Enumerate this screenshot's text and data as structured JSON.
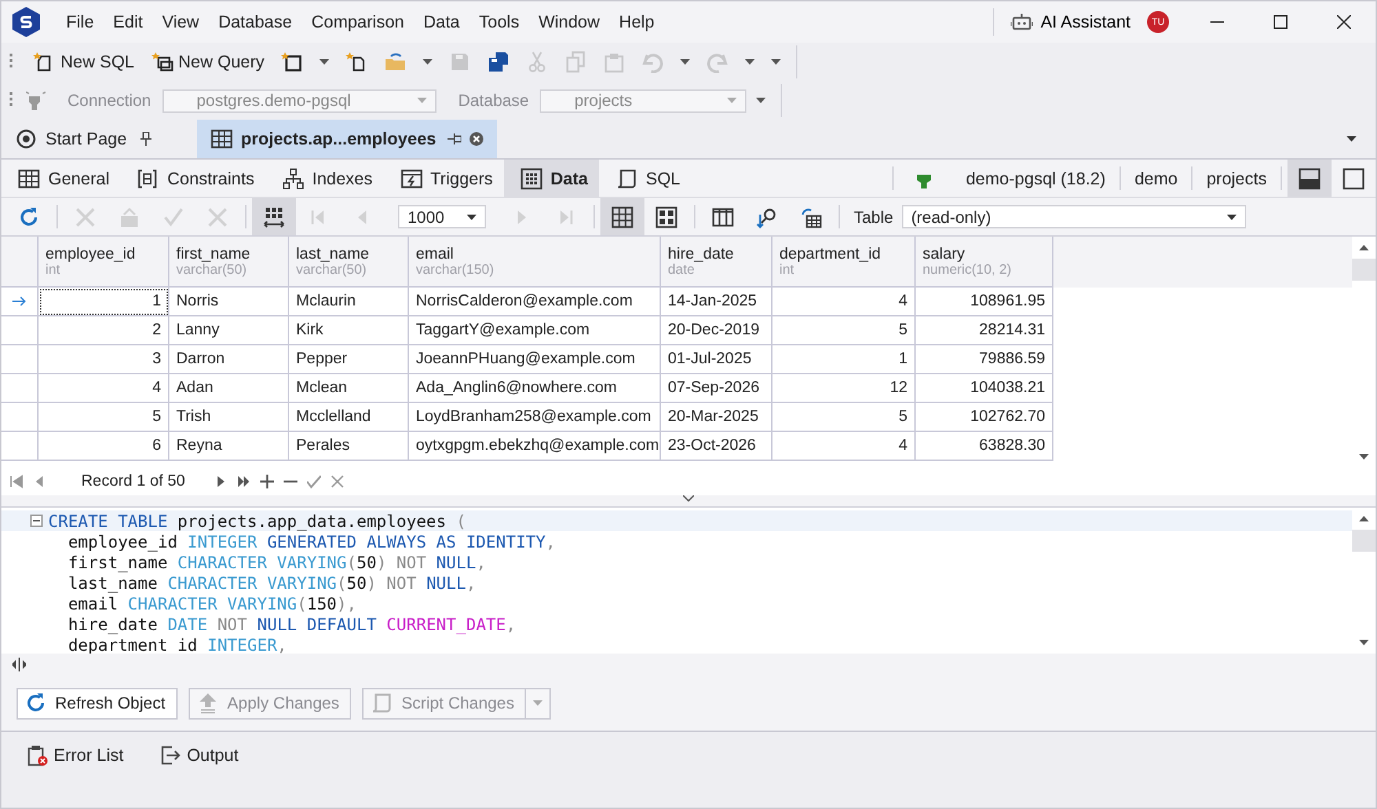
{
  "menu": [
    "File",
    "Edit",
    "View",
    "Database",
    "Comparison",
    "Data",
    "Tools",
    "Window",
    "Help"
  ],
  "ai_assistant": "AI Assistant",
  "avatar": "TU",
  "toolbar": [
    {
      "label": "New SQL",
      "disabled": false,
      "dropdown": false
    },
    {
      "label": "New Query",
      "disabled": false,
      "dropdown": false
    },
    {
      "disabled": false,
      "dropdown": true
    },
    {
      "disabled": false,
      "dropdown": false
    },
    {
      "disabled": false,
      "dropdown": true
    },
    {
      "disabled": true,
      "dropdown": false
    },
    {
      "disabled": false,
      "dropdown": false
    },
    {
      "disabled": true,
      "dropdown": false
    },
    {
      "disabled": true,
      "dropdown": false
    },
    {
      "disabled": true,
      "dropdown": false
    },
    {
      "disabled": true,
      "dropdown": true
    },
    {
      "disabled": true,
      "dropdown": true
    }
  ],
  "connection": {
    "label": "Connection",
    "value": "postgres.demo-pgsql",
    "disabled": true
  },
  "database": {
    "label": "Database",
    "value": "projects",
    "disabled": true
  },
  "doc_tabs": [
    {
      "label": "Start Page",
      "selected": false
    },
    {
      "label": "projects.ap...employees",
      "selected": true
    }
  ],
  "editor_tabs": [
    {
      "label": "General",
      "selected": false
    },
    {
      "label": "Constraints",
      "selected": false
    },
    {
      "label": "Indexes",
      "selected": false
    },
    {
      "label": "Triggers",
      "selected": false
    },
    {
      "label": "Data",
      "selected": true
    },
    {
      "label": "SQL",
      "selected": false
    }
  ],
  "connection_info": [
    "demo-pgsql (18.2)",
    "demo",
    "projects"
  ],
  "layout_buttons": [
    {
      "selected": true
    },
    {
      "selected": false
    }
  ],
  "data_toolbar": [
    {
      "disabled": false,
      "selected": false
    },
    {
      "disabled": true,
      "selected": false
    },
    {
      "disabled": true,
      "selected": false
    },
    {
      "disabled": true,
      "selected": false
    },
    {
      "disabled": true,
      "selected": false
    },
    {
      "disabled": false,
      "selected": true
    },
    {
      "disabled": true,
      "selected": false
    },
    {
      "disabled": true,
      "selected": false
    }
  ],
  "page_size": "1000",
  "data_toolbar_right": [
    {
      "disabled": true,
      "selected": false
    },
    {
      "disabled": true,
      "selected": false
    },
    {
      "disabled": false,
      "selected": true
    },
    {
      "disabled": false,
      "selected": false
    },
    {
      "disabled": false,
      "selected": false
    },
    {
      "disabled": false,
      "selected": false
    },
    {
      "disabled": false,
      "selected": false
    }
  ],
  "table_label": "Table",
  "table_value": "(read-only)",
  "grid": {
    "columns": [
      {
        "name": "employee_id",
        "type": "int",
        "kind": "number"
      },
      {
        "name": "first_name",
        "type": "varchar(50)",
        "kind": "text"
      },
      {
        "name": "last_name",
        "type": "varchar(50)",
        "kind": "text"
      },
      {
        "name": "email",
        "type": "varchar(150)",
        "kind": "text"
      },
      {
        "name": "hire_date",
        "type": "date",
        "kind": "text"
      },
      {
        "name": "department_id",
        "type": "int",
        "kind": "number"
      },
      {
        "name": "salary",
        "type": "numeric(10, 2)",
        "kind": "number"
      }
    ],
    "rows": [
      {
        "current": true,
        "cells": [
          "1",
          "Norris",
          "Mclaurin",
          "NorrisCalderon@example.com",
          "14-Jan-2025",
          "4",
          "108961.95"
        ]
      },
      {
        "current": false,
        "cells": [
          "2",
          "Lanny",
          "Kirk",
          "TaggartY@example.com",
          "20-Dec-2019",
          "5",
          "28214.31"
        ]
      },
      {
        "current": false,
        "cells": [
          "3",
          "Darron",
          "Pepper",
          "JoeannPHuang@example.com",
          "01-Jul-2025",
          "1",
          "79886.59"
        ]
      },
      {
        "current": false,
        "cells": [
          "4",
          "Adan",
          "Mclean",
          "Ada_Anglin6@nowhere.com",
          "07-Sep-2026",
          "12",
          "104038.21"
        ]
      },
      {
        "current": false,
        "cells": [
          "5",
          "Trish",
          "Mcclelland",
          "LoydBranham258@example.com",
          "20-Mar-2025",
          "5",
          "102762.70"
        ]
      },
      {
        "current": false,
        "cells": [
          "6",
          "Reyna",
          "Perales",
          "oytxgpgm.ebekzhq@example.com",
          "23-Oct-2026",
          "4",
          "63828.30"
        ]
      }
    ]
  },
  "record_text": "Record 1 of 50",
  "code": [
    [
      {
        "t": "CREATE TABLE",
        "kind": "keyword"
      },
      {
        "t": " projects.app_data.employees ",
        "kind": "plain"
      },
      {
        "t": "(",
        "kind": "punct"
      }
    ],
    [
      {
        "t": "  employee_id ",
        "kind": "plain"
      },
      {
        "t": "INTEGER",
        "kind": "type"
      },
      {
        "t": " GENERATED ALWAYS AS IDENTITY",
        "kind": "keyword"
      },
      {
        "t": ",",
        "kind": "punct"
      }
    ],
    [
      {
        "t": "  first_name ",
        "kind": "plain"
      },
      {
        "t": "CHARACTER VARYING",
        "kind": "type"
      },
      {
        "t": "(",
        "kind": "punct"
      },
      {
        "t": "50",
        "kind": "plain"
      },
      {
        "t": ") NOT",
        "kind": "punct"
      },
      {
        "t": " NULL",
        "kind": "keyword"
      },
      {
        "t": ",",
        "kind": "punct"
      }
    ],
    [
      {
        "t": "  last_name ",
        "kind": "plain"
      },
      {
        "t": "CHARACTER VARYING",
        "kind": "type"
      },
      {
        "t": "(",
        "kind": "punct"
      },
      {
        "t": "50",
        "kind": "plain"
      },
      {
        "t": ") NOT",
        "kind": "punct"
      },
      {
        "t": " NULL",
        "kind": "keyword"
      },
      {
        "t": ",",
        "kind": "punct"
      }
    ],
    [
      {
        "t": "  email ",
        "kind": "plain"
      },
      {
        "t": "CHARACTER VARYING",
        "kind": "type"
      },
      {
        "t": "(",
        "kind": "punct"
      },
      {
        "t": "150",
        "kind": "plain"
      },
      {
        "t": "),",
        "kind": "punct"
      }
    ],
    [
      {
        "t": "  hire_date ",
        "kind": "plain"
      },
      {
        "t": "DATE",
        "kind": "type"
      },
      {
        "t": " NOT",
        "kind": "punct"
      },
      {
        "t": " NULL DEFAULT ",
        "kind": "keyword"
      },
      {
        "t": "CURRENT_DATE",
        "kind": "function"
      },
      {
        "t": ",",
        "kind": "punct"
      }
    ],
    [
      {
        "t": "  department_id ",
        "kind": "plain"
      },
      {
        "t": "INTEGER",
        "kind": "type"
      },
      {
        "t": ",",
        "kind": "punct"
      }
    ]
  ],
  "bottom_buttons": [
    {
      "label": "Refresh Object",
      "disabled": false,
      "dropdown": false
    },
    {
      "label": "Apply Changes",
      "disabled": true,
      "dropdown": false
    },
    {
      "label": "Script Changes",
      "disabled": true,
      "dropdown": true
    }
  ],
  "panel_tabs": [
    "Error List",
    "Output"
  ]
}
